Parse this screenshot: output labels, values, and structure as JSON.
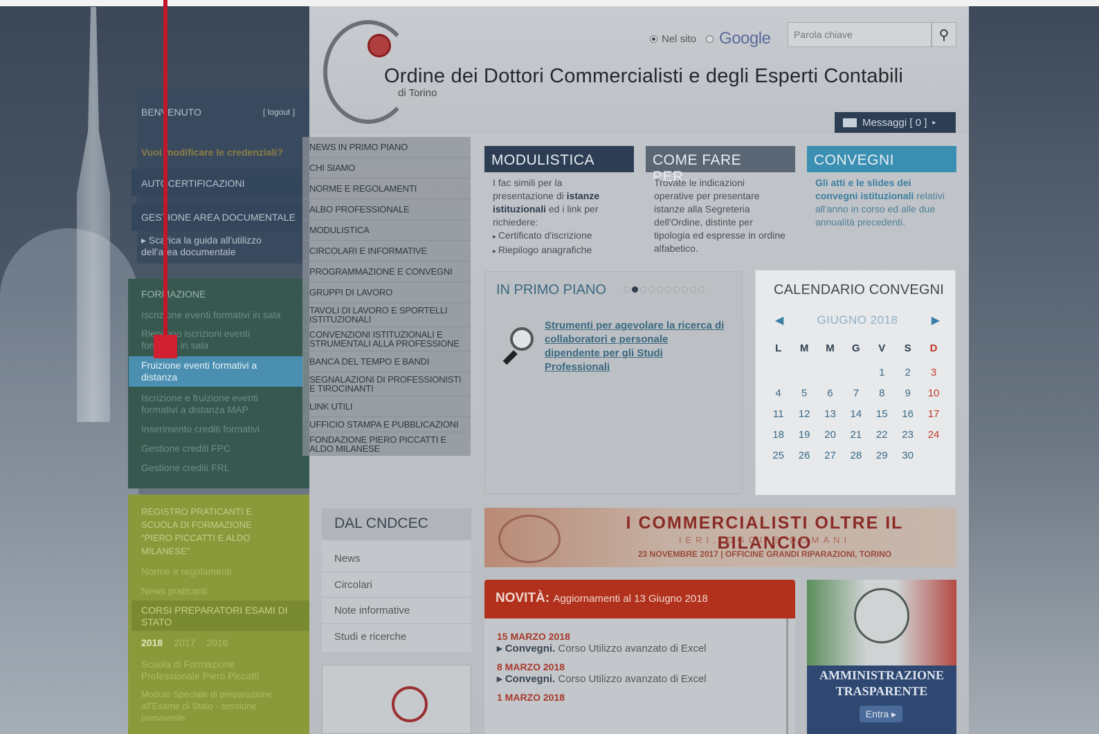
{
  "header": {
    "title": "Ordine dei Dottori Commercialisti e degli Esperti Contabili",
    "subtitle": "di Torino",
    "radio_site": "Nel sito",
    "radio_google": "Google",
    "search_placeholder": "Parola chiave",
    "messages": "Messaggi [ 0 ]"
  },
  "sidebar": {
    "welcome": "BENVENUTO",
    "logout": "[ logout ]",
    "change_credentials": "Vuoi modificare le credenziali?",
    "autocert": "AUTOCERTIFICAZIONI",
    "gestione_area": "GESTIONE AREA DOCUMENTALE",
    "guide": "▸ Scarica la guida all'utilizzo dell'area documentale",
    "formazione": "FORMAZIONE",
    "f_items": [
      "Iscrizione eventi formativi in sala",
      "Riepilogo iscrizioni eventi formativi in sala",
      "Fruizione eventi formativi a distanza",
      "Iscrizione e fruizione eventi formativi a distanza MAP",
      "Inserimento crediti formativi",
      "Gestione crediti FPC",
      "Gestione crediti FRL"
    ],
    "registro": "REGISTRO PRATICANTI E SCUOLA DI FORMAZIONE \"PIERO PICCATTI E ALDO MILANESE\"",
    "norme": "Norme e regolamenti",
    "news_praticanti": "News praticanti",
    "corsi": "CORSI PREPARATORI ESAMI DI STATO",
    "years": [
      "2018",
      "2017",
      "2016"
    ],
    "scuola": "Scuola di Formazione Professionale Piero Piccatti",
    "modulo": "Modulo Speciale di preparazione all'Esame di Stato - sessione primaverile"
  },
  "menu": [
    "NEWS IN PRIMO PIANO",
    "CHI SIAMO",
    "NORME E REGOLAMENTI",
    "ALBO PROFESSIONALE",
    "MODULISTICA",
    "CIRCOLARI E INFORMATIVE",
    "PROGRAMMAZIONE E CONVEGNI",
    "GRUPPI DI LAVORO",
    "TAVOLI DI LAVORO E SPORTELLI ISTITUZIONALI",
    "CONVENZIONI ISTITUZIONALI E STRUMENTALI ALLA PROFESSIONE",
    "BANCA DEL TEMPO E BANDI",
    "SEGNALAZIONI DI PROFESSIONISTI E TIROCINANTI",
    "LINK UTILI",
    "UFFICIO STAMPA E PUBBLICAZIONI",
    "FONDAZIONE PIERO PICCATTI E ALDO MILANESE"
  ],
  "boxes": {
    "modulistica": {
      "title": "MODULISTICA",
      "text_a": "I fac simili per la presentazione di ",
      "text_b": "istanze istituzionali",
      "text_c": " ed i link per richiedere:",
      "items": [
        "Certificato d'iscrizione",
        "Riepilogo anagrafiche"
      ]
    },
    "come_fare": {
      "title": "COME FARE PER...",
      "text": "Trovate le indicazioni operative per presentare istanze alla Segreteria dell'Ordine, distinte per tipologia ed espresse in ordine alfabetico."
    },
    "convegni": {
      "title": "CONVEGNI",
      "text_a": "Gli atti e le slides dei convegni istituzionali",
      "text_b": " relativi all'anno in corso ed alle due annualità precedenti."
    }
  },
  "primo_piano": {
    "title": "IN PRIMO PIANO",
    "link": "Strumenti per agevolare la ricerca di collaboratori e personale dipendente per gli Studi Professionali",
    "slide_count": 10,
    "active_slide": 2
  },
  "calendar": {
    "title": "CALENDARIO CONVEGNI",
    "month": "GIUGNO 2018",
    "weekdays": [
      "L",
      "M",
      "M",
      "G",
      "V",
      "S",
      "D"
    ],
    "weeks": [
      [
        "",
        "",
        "",
        "",
        "1",
        "2",
        "3"
      ],
      [
        "4",
        "5",
        "6",
        "7",
        "8",
        "9",
        "10"
      ],
      [
        "11",
        "12",
        "13",
        "14",
        "15",
        "16",
        "17"
      ],
      [
        "18",
        "19",
        "20",
        "21",
        "22",
        "23",
        "24"
      ],
      [
        "25",
        "26",
        "27",
        "28",
        "29",
        "30",
        ""
      ]
    ]
  },
  "banner": {
    "title": "I COMMERCIALISTI OLTRE IL BILANCIO",
    "sub": "IERI, OGGI E DOMANI",
    "date": "23 NOVEMBRE 2017 | OFFICINE GRANDI RIPARAZIONI, TORINO"
  },
  "dal_cndcec": {
    "title": "DAL CNDCEC",
    "items": [
      "News",
      "Circolari",
      "Note informative",
      "Studi e ricerche"
    ]
  },
  "novita": {
    "label": "NOVITÀ:",
    "sub": "Aggiornamenti al 13 Giugno 2018",
    "entries": [
      {
        "date": "15 MARZO 2018",
        "cat": "▸ Convegni.",
        "text": " Corso Utilizzo avanzato di Excel"
      },
      {
        "date": "8 MARZO 2018",
        "cat": "▸ Convegni.",
        "text": " Corso Utilizzo avanzato di Excel"
      },
      {
        "date": "1 MARZO 2018",
        "cat": "",
        "text": ""
      }
    ]
  },
  "trasparente": {
    "line1": "AMMINISTRAZIONE",
    "line2": "TRASPARENTE",
    "button": "Entra ▸"
  }
}
